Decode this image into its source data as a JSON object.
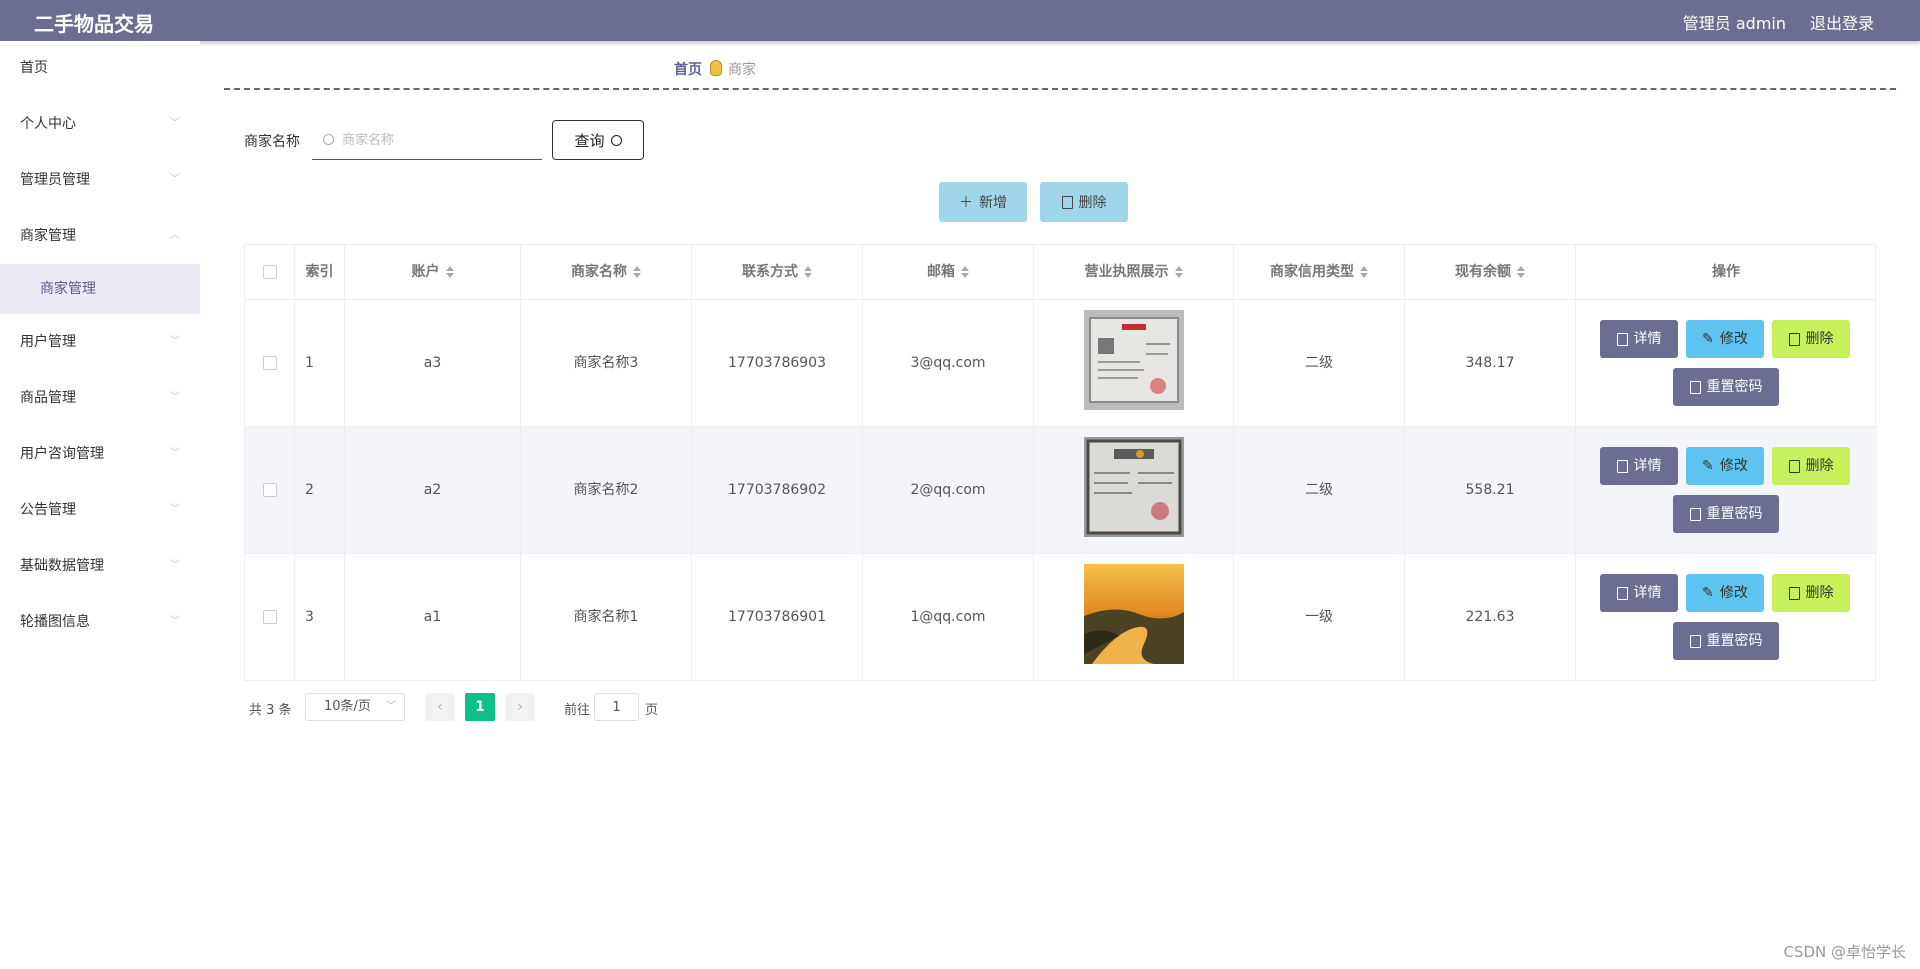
{
  "header": {
    "title": "二手物品交易",
    "admin": "管理员 admin",
    "logout": "退出登录"
  },
  "sidebar": {
    "items": [
      {
        "label": "首页"
      },
      {
        "label": "个人中心"
      },
      {
        "label": "管理员管理"
      },
      {
        "label": "商家管理"
      },
      {
        "label": "用户管理"
      },
      {
        "label": "商品管理"
      },
      {
        "label": "用户咨询管理"
      },
      {
        "label": "公告管理"
      },
      {
        "label": "基础数据管理"
      },
      {
        "label": "轮播图信息"
      }
    ],
    "sub_active": "商家管理"
  },
  "breadcrumb": {
    "home": "首页",
    "current": "商家"
  },
  "search": {
    "label": "商家名称",
    "placeholder": "商家名称",
    "button": "查询"
  },
  "actions": {
    "add": "新增",
    "delete": "删除"
  },
  "table": {
    "headers": [
      "索引",
      "账户",
      "商家名称",
      "联系方式",
      "邮箱",
      "营业执照展示",
      "商家信用类型",
      "现有余额",
      "操作"
    ],
    "rows": [
      {
        "index": "1",
        "account": "a3",
        "name": "商家名称3",
        "phone": "17703786903",
        "email": "3@qq.com",
        "credit": "二级",
        "balance": "348.17"
      },
      {
        "index": "2",
        "account": "a2",
        "name": "商家名称2",
        "phone": "17703786902",
        "email": "2@qq.com",
        "credit": "二级",
        "balance": "558.21"
      },
      {
        "index": "3",
        "account": "a1",
        "name": "商家名称1",
        "phone": "17703786901",
        "email": "1@qq.com",
        "credit": "一级",
        "balance": "221.63"
      }
    ],
    "ops": {
      "detail": "详情",
      "edit": "修改",
      "remove": "删除",
      "reset": "重置密码"
    }
  },
  "pagination": {
    "total": "共 3 条",
    "page_size": "10条/页",
    "current": "1",
    "goto_label": "前往",
    "goto_value": "1",
    "page_suffix": "页"
  },
  "watermark": "CSDN @卓怡学长"
}
